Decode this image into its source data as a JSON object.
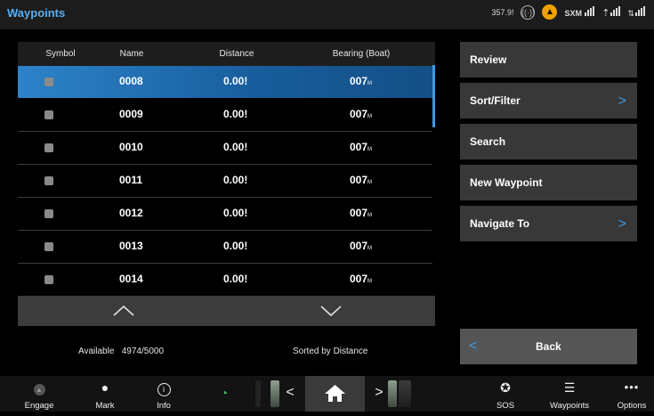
{
  "app": {
    "title": "Waypoints"
  },
  "status": {
    "gps_value": "357.9!",
    "sxm_label": "SXM"
  },
  "table": {
    "columns": [
      "Symbol",
      "Name",
      "Distance",
      "Bearing (Boat)"
    ],
    "selected_index": 0,
    "rows": [
      {
        "name": "0008",
        "distance": "0.00!",
        "bearing": "007",
        "bearing_suffix": "M"
      },
      {
        "name": "0009",
        "distance": "0.00!",
        "bearing": "007",
        "bearing_suffix": "M"
      },
      {
        "name": "0010",
        "distance": "0.00!",
        "bearing": "007",
        "bearing_suffix": "M"
      },
      {
        "name": "0011",
        "distance": "0.00!",
        "bearing": "007",
        "bearing_suffix": "M"
      },
      {
        "name": "0012",
        "distance": "0.00!",
        "bearing": "007",
        "bearing_suffix": "M"
      },
      {
        "name": "0013",
        "distance": "0.00!",
        "bearing": "007",
        "bearing_suffix": "M"
      },
      {
        "name": "0014",
        "distance": "0.00!",
        "bearing": "007",
        "bearing_suffix": "M"
      }
    ]
  },
  "footer": {
    "available_label": "Available",
    "available_value": "4974/5000",
    "sorted_label": "Sorted by Distance"
  },
  "menu": {
    "review": "Review",
    "sort_filter": "Sort/Filter",
    "search": "Search",
    "new_waypoint": "New Waypoint",
    "navigate_to": "Navigate To",
    "back": "Back"
  },
  "bottom": {
    "engage": "Engage",
    "mark": "Mark",
    "info": "Info",
    "sos": "SOS",
    "waypoints": "Waypoints",
    "options": "Options"
  },
  "colors": {
    "accent": "#3b9ae6",
    "title": "#5aaef0",
    "selected_row": "#2d83c9",
    "button": "#383838",
    "ais": "#f0a000"
  }
}
